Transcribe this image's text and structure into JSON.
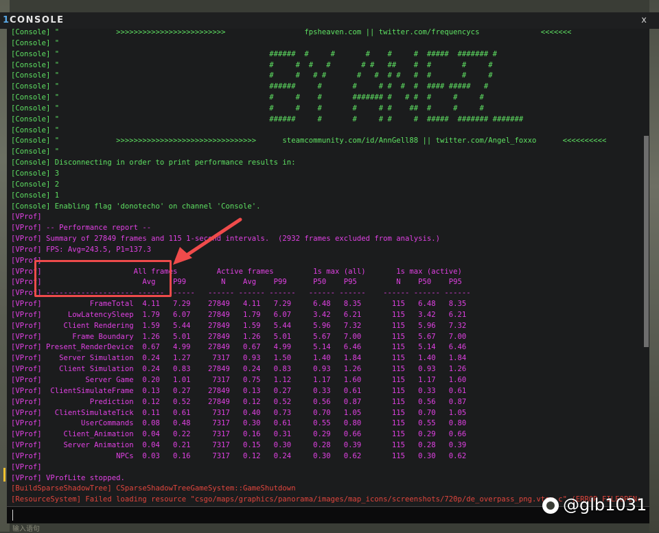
{
  "window": {
    "title_accent": "1",
    "title": "CONSOLE",
    "close_label": "x"
  },
  "colors": {
    "console_green": "#5ee062",
    "vprof_magenta": "#e041e3",
    "error_red": "#e0453d",
    "highlight_red": "#ef4b4b"
  },
  "log_lines": [
    {
      "text": "[Console] \"             >>>>>>>>>>>>>>>>>>>>>>>>>                  fpsheaven.com || twitter.com/frequencycs              <<<<<<<",
      "color": "green"
    },
    {
      "text": "[Console] \"",
      "color": "green"
    },
    {
      "text": "[Console] \"                                                ######  #     #       #    #     #  #####  ####### #",
      "color": "green"
    },
    {
      "text": "[Console] \"                                                #     #  #   #       # #   ##    #  #       #     #",
      "color": "green"
    },
    {
      "text": "[Console] \"                                                #     #   # #       #   #  # #   #  #       #     #",
      "color": "green"
    },
    {
      "text": "[Console] \"                                                ######     #       #     # #  #  #  #### #####   #",
      "color": "green"
    },
    {
      "text": "[Console] \"                                                #     #    #       ####### #   # #  #     #     #",
      "color": "green"
    },
    {
      "text": "[Console] \"                                                #     #    #       #     # #    ##  #     #     #",
      "color": "green"
    },
    {
      "text": "[Console] \"                                                ######     #       #     # #     #  #####  ####### #######",
      "color": "green"
    },
    {
      "text": "[Console] \"",
      "color": "green"
    },
    {
      "text": "[Console] \"             >>>>>>>>>>>>>>>>>>>>>>>>>>>>>>>>      steamcommunity.com/id/AnnGell88 || twitter.com/Angel_foxxo      <<<<<<<<<<",
      "color": "green"
    },
    {
      "text": "[Console] \"",
      "color": "green"
    },
    {
      "text": "[Console] Disconnecting in order to print performance results in:",
      "color": "green"
    },
    {
      "text": "[Console] 3",
      "color": "green"
    },
    {
      "text": "[Console] 2",
      "color": "green"
    },
    {
      "text": "[Console] 1",
      "color": "green"
    },
    {
      "text": "[Console] Enabling flag 'donotecho' on channel 'Console'.",
      "color": "green"
    },
    {
      "text": "[VProf]",
      "color": "mag"
    },
    {
      "text": "[VProf] -- Performance report --",
      "color": "mag"
    },
    {
      "text": "[VProf] Summary of 27849 frames and 115 1-second intervals.  (2932 frames excluded from analysis.)",
      "color": "mag"
    },
    {
      "text": "[VProf] FPS: Avg=243.5, P1=137.3",
      "color": "mag"
    },
    {
      "text": "[VProf]",
      "color": "mag"
    },
    {
      "text": "[VProf]                     All frames         Active frames         1s max (all)       1s max (active)",
      "color": "mag"
    },
    {
      "text": "[VProf]                       Avg    P99        N    Avg    P99      P50    P95         N    P50    P95",
      "color": "mag"
    },
    {
      "text": "[VProf] -------------------- ------ ------   ------ ------ ------   ------ ------    ------ ------ ------",
      "color": "mag"
    },
    {
      "text": "[VProf]           FrameTotal  4.11   7.29    27849   4.11   7.29     6.48   8.35       115   6.48   8.35",
      "color": "mag"
    },
    {
      "text": "[VProf]      LowLatencySleep  1.79   6.07    27849   1.79   6.07     3.42   6.21       115   3.42   6.21",
      "color": "mag"
    },
    {
      "text": "[VProf]     Client Rendering  1.59   5.44    27849   1.59   5.44     5.96   7.32       115   5.96   7.32",
      "color": "mag"
    },
    {
      "text": "[VProf]       Frame Boundary  1.26   5.01    27849   1.26   5.01     5.67   7.00       115   5.67   7.00",
      "color": "mag"
    },
    {
      "text": "[VProf] Present_RenderDevice  0.67   4.99    27849   0.67   4.99     5.14   6.46       115   5.14   6.46",
      "color": "mag"
    },
    {
      "text": "[VProf]    Server Simulation  0.24   1.27     7317   0.93   1.50     1.40   1.84       115   1.40   1.84",
      "color": "mag"
    },
    {
      "text": "[VProf]    Client Simulation  0.24   0.83    27849   0.24   0.83     0.93   1.26       115   0.93   1.26",
      "color": "mag"
    },
    {
      "text": "[VProf]          Server Game  0.20   1.01     7317   0.75   1.12     1.17   1.60       115   1.17   1.60",
      "color": "mag"
    },
    {
      "text": "[VProf]  ClientSimulateFrame  0.13   0.27    27849   0.13   0.27     0.33   0.61       115   0.33   0.61",
      "color": "mag"
    },
    {
      "text": "[VProf]           Prediction  0.12   0.52    27849   0.12   0.52     0.56   0.87       115   0.56   0.87",
      "color": "mag"
    },
    {
      "text": "[VProf]   ClientSimulateTick  0.11   0.61     7317   0.40   0.73     0.70   1.05       115   0.70   1.05",
      "color": "mag"
    },
    {
      "text": "[VProf]         UserCommands  0.08   0.48     7317   0.30   0.61     0.55   0.80       115   0.55   0.80",
      "color": "mag"
    },
    {
      "text": "[VProf]     Client_Animation  0.04   0.22     7317   0.16   0.31     0.29   0.66       115   0.29   0.66",
      "color": "mag"
    },
    {
      "text": "[VProf]     Server Animation  0.04   0.21     7317   0.15   0.30     0.28   0.39       115   0.28   0.39",
      "color": "mag"
    },
    {
      "text": "[VProf]                 NPCs  0.03   0.16     7317   0.12   0.24     0.30   0.62       115   0.30   0.62",
      "color": "mag"
    },
    {
      "text": "[VProf]",
      "color": "mag"
    },
    {
      "text": "[VProf] VProfLite stopped.",
      "color": "mag"
    },
    {
      "text": "[BuildSparseShadowTree] CSparseShadowTreeGameSystem::GameShutdown",
      "color": "red"
    },
    {
      "text": "[ResourceSystem] Failed loading resource \"csgo/maps/graphics/panorama/images/map_icons/screenshots/720p/de_overpass_png.vtex_c\" (ERROR_FILEOPEN: File not found)",
      "color": "red"
    }
  ],
  "input": {
    "value": ""
  },
  "footer_hint": "输入语句",
  "watermark": "@glb1031"
}
